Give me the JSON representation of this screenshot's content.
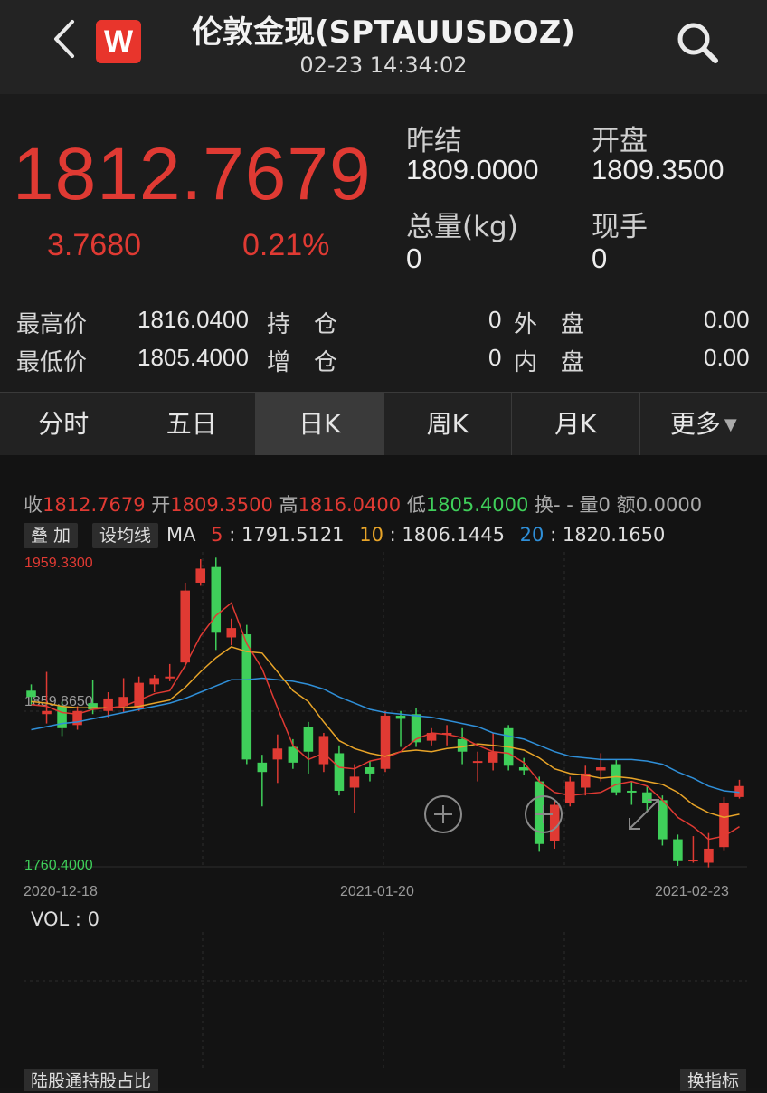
{
  "header": {
    "logo_text": "W",
    "title": "伦敦金现(SPTAUUSDOZ)",
    "time": "02-23 14:34:02",
    "icons": [
      "back-chevron-icon",
      "search-icon"
    ]
  },
  "quote": {
    "price": "1812.7679",
    "change": "3.7680",
    "change_pct": "0.21%",
    "prev_close_label": "昨结",
    "prev_close": "1809.0000",
    "open_label": "开盘",
    "open": "1809.3500",
    "volume_label": "总量(kg)",
    "volume": "0",
    "current_hand_label": "现手",
    "current_hand": "0",
    "high_label": "最高价",
    "high": "1816.0400",
    "low_label": "最低价",
    "low": "1805.4000",
    "open_interest_label": "持　仓",
    "open_interest": "0",
    "add_position_label": "增　仓",
    "add_position": "0",
    "outer_label": "外　盘",
    "outer": "0.00",
    "inner_label": "内　盘",
    "inner": "0.00",
    "up_color": "#e03a33",
    "down_color": "#3fcf5a"
  },
  "tabs": [
    {
      "label": "分时",
      "active": false
    },
    {
      "label": "五日",
      "active": false
    },
    {
      "label": "日K",
      "active": true
    },
    {
      "label": "周K",
      "active": false
    },
    {
      "label": "月K",
      "active": false
    },
    {
      "label": "更多",
      "active": false
    }
  ],
  "chart_info": {
    "close_label": "收",
    "close": "1812.7679",
    "open_label": "开",
    "open": "1809.3500",
    "high_label": "高",
    "high": "1816.0400",
    "low_label": "低",
    "low": "1805.4000",
    "turnover_label": "换",
    "turnover": "- -",
    "vol_label": "量",
    "vol": "0",
    "amount_label": "额",
    "amount": "0.0000",
    "overlay_btn": "叠 加",
    "ma_btn": "设均线",
    "ma_label": "MA",
    "ma5_key": "5",
    "ma5": "1791.5121",
    "ma10_key": "10",
    "ma10": "1806.1445",
    "ma20_key": "20",
    "ma20": "1820.1650",
    "ma5_color": "#e03a33",
    "ma10_color": "#e8a428",
    "ma20_color": "#2f8fd8",
    "vol_text": "VOL :  0",
    "bottom_left_btn": "陆股通持股占比",
    "bottom_right_btn": "换指标"
  },
  "chart_data": {
    "type": "candlestick",
    "y_max_label": "1959.3300",
    "y_mid_label": "1859.8650",
    "y_min_label": "1760.4000",
    "ylim": [
      1760.4,
      1959.33
    ],
    "x_labels": [
      "2020-12-18",
      "2021-01-20",
      "2021-02-23"
    ],
    "candles": [
      {
        "o": 1873,
        "c": 1869,
        "h": 1877,
        "l": 1864
      },
      {
        "o": 1858,
        "c": 1860,
        "h": 1885,
        "l": 1852
      },
      {
        "o": 1863,
        "c": 1849,
        "h": 1866,
        "l": 1844
      },
      {
        "o": 1851,
        "c": 1860,
        "h": 1863,
        "l": 1848
      },
      {
        "o": 1865,
        "c": 1861,
        "h": 1880,
        "l": 1858
      },
      {
        "o": 1860,
        "c": 1868,
        "h": 1872,
        "l": 1856
      },
      {
        "o": 1863,
        "c": 1869,
        "h": 1881,
        "l": 1859
      },
      {
        "o": 1862,
        "c": 1878,
        "h": 1882,
        "l": 1860
      },
      {
        "o": 1877,
        "c": 1881,
        "h": 1883,
        "l": 1872
      },
      {
        "o": 1882,
        "c": 1882,
        "h": 1890,
        "l": 1879
      },
      {
        "o": 1891,
        "c": 1937,
        "h": 1942,
        "l": 1888
      },
      {
        "o": 1942,
        "c": 1951,
        "h": 1957,
        "l": 1940
      },
      {
        "o": 1952,
        "c": 1910,
        "h": 1958,
        "l": 1899
      },
      {
        "o": 1907,
        "c": 1913,
        "h": 1919,
        "l": 1902
      },
      {
        "o": 1909,
        "c": 1829,
        "h": 1915,
        "l": 1826
      },
      {
        "o": 1827,
        "c": 1821,
        "h": 1832,
        "l": 1799
      },
      {
        "o": 1829,
        "c": 1836,
        "h": 1845,
        "l": 1814
      },
      {
        "o": 1837,
        "c": 1827,
        "h": 1842,
        "l": 1823
      },
      {
        "o": 1850,
        "c": 1834,
        "h": 1853,
        "l": 1820
      },
      {
        "o": 1826,
        "c": 1844,
        "h": 1846,
        "l": 1821
      },
      {
        "o": 1833,
        "c": 1809,
        "h": 1838,
        "l": 1806
      },
      {
        "o": 1811,
        "c": 1818,
        "h": 1826,
        "l": 1795
      },
      {
        "o": 1824,
        "c": 1820,
        "h": 1828,
        "l": 1815
      },
      {
        "o": 1823,
        "c": 1857,
        "h": 1860,
        "l": 1821
      },
      {
        "o": 1857,
        "c": 1855,
        "h": 1860,
        "l": 1837
      },
      {
        "o": 1858,
        "c": 1840,
        "h": 1862,
        "l": 1837
      },
      {
        "o": 1841,
        "c": 1846,
        "h": 1849,
        "l": 1838
      },
      {
        "o": 1846,
        "c": 1846,
        "h": 1851,
        "l": 1838
      },
      {
        "o": 1842,
        "c": 1834,
        "h": 1849,
        "l": 1826
      },
      {
        "o": 1828,
        "c": 1828,
        "h": 1834,
        "l": 1815
      },
      {
        "o": 1827,
        "c": 1834,
        "h": 1846,
        "l": 1822
      },
      {
        "o": 1849,
        "c": 1825,
        "h": 1851,
        "l": 1822
      },
      {
        "o": 1824,
        "c": 1822,
        "h": 1830,
        "l": 1819
      },
      {
        "o": 1815,
        "c": 1775,
        "h": 1818,
        "l": 1770
      },
      {
        "o": 1777,
        "c": 1800,
        "h": 1803,
        "l": 1772
      },
      {
        "o": 1801,
        "c": 1815,
        "h": 1818,
        "l": 1799
      },
      {
        "o": 1811,
        "c": 1820,
        "h": 1825,
        "l": 1806
      },
      {
        "o": 1822,
        "c": 1824,
        "h": 1833,
        "l": 1815
      },
      {
        "o": 1826,
        "c": 1808,
        "h": 1829,
        "l": 1806
      },
      {
        "o": 1809,
        "c": 1808,
        "h": 1815,
        "l": 1800
      },
      {
        "o": 1808,
        "c": 1801,
        "h": 1812,
        "l": 1796
      },
      {
        "o": 1803,
        "c": 1778,
        "h": 1806,
        "l": 1774
      },
      {
        "o": 1778,
        "c": 1764,
        "h": 1781,
        "l": 1761
      },
      {
        "o": 1765,
        "c": 1765,
        "h": 1780,
        "l": 1763
      },
      {
        "o": 1763,
        "c": 1772,
        "h": 1782,
        "l": 1760
      },
      {
        "o": 1773,
        "c": 1801,
        "h": 1805,
        "l": 1771
      },
      {
        "o": 1805,
        "c": 1812,
        "h": 1816,
        "l": 1804
      }
    ],
    "ma5": [
      1864,
      1863,
      1859,
      1858,
      1861,
      1862,
      1863,
      1867,
      1871,
      1873,
      1889,
      1908,
      1921,
      1929,
      1903,
      1887,
      1862,
      1838,
      1829,
      1833,
      1824,
      1823,
      1828,
      1830,
      1834,
      1842,
      1846,
      1845,
      1843,
      1838,
      1834,
      1833,
      1827,
      1815,
      1808,
      1806,
      1807,
      1808,
      1813,
      1815,
      1812,
      1803,
      1792,
      1786,
      1778,
      1780,
      1786
    ],
    "ma10": [
      1866,
      1865,
      1863,
      1862,
      1862,
      1862,
      1862,
      1863,
      1865,
      1867,
      1875,
      1885,
      1894,
      1901,
      1898,
      1897,
      1885,
      1873,
      1866,
      1853,
      1841,
      1836,
      1833,
      1831,
      1834,
      1835,
      1834,
      1836,
      1837,
      1839,
      1838,
      1837,
      1835,
      1830,
      1823,
      1820,
      1819,
      1817,
      1818,
      1817,
      1815,
      1813,
      1808,
      1800,
      1795,
      1792,
      1794
    ],
    "ma20": [
      1848,
      1850,
      1852,
      1853,
      1855,
      1857,
      1859,
      1861,
      1863,
      1865,
      1868,
      1872,
      1876,
      1880,
      1880,
      1881,
      1880,
      1879,
      1877,
      1874,
      1869,
      1865,
      1861,
      1859,
      1858,
      1857,
      1856,
      1854,
      1852,
      1850,
      1846,
      1844,
      1842,
      1838,
      1834,
      1831,
      1830,
      1829,
      1829,
      1829,
      1828,
      1826,
      1821,
      1817,
      1812,
      1809,
      1808
    ]
  }
}
